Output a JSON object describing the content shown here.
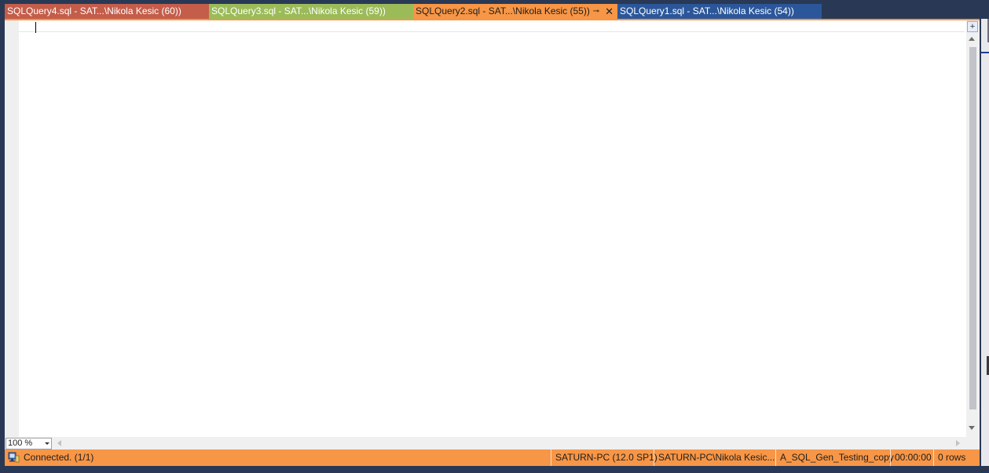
{
  "tabs": [
    {
      "label": "SQLQuery4.sql - SAT...\\Nikola Kesic (60))",
      "color": "#c45d4a"
    },
    {
      "label": "SQLQuery3.sql - SAT...\\Nikola Kesic (59))",
      "color": "#9bbb59"
    },
    {
      "label": "SQLQuery2.sql - SAT...\\Nikola Kesic (55))",
      "color": "#f79646",
      "active": true,
      "pin_icon": "pin-icon",
      "close_icon": "close-icon"
    },
    {
      "label": "SQLQuery1.sql - SAT...\\Nikola Kesic (54))",
      "color": "#2b579a"
    }
  ],
  "editor": {
    "zoom": "100 %"
  },
  "status": {
    "icon": "connected-server-icon",
    "connection": "Connected. (1/1)",
    "server": "SATURN-PC (12.0 SP1)",
    "user": "SATURN-PC\\Nikola Kesic...",
    "database": "A_SQL_Gen_Testing_copy",
    "elapsed": "00:00:00",
    "rows": "0 rows"
  },
  "colors": {
    "status_bar": "#f79646",
    "chrome": "#293955"
  }
}
